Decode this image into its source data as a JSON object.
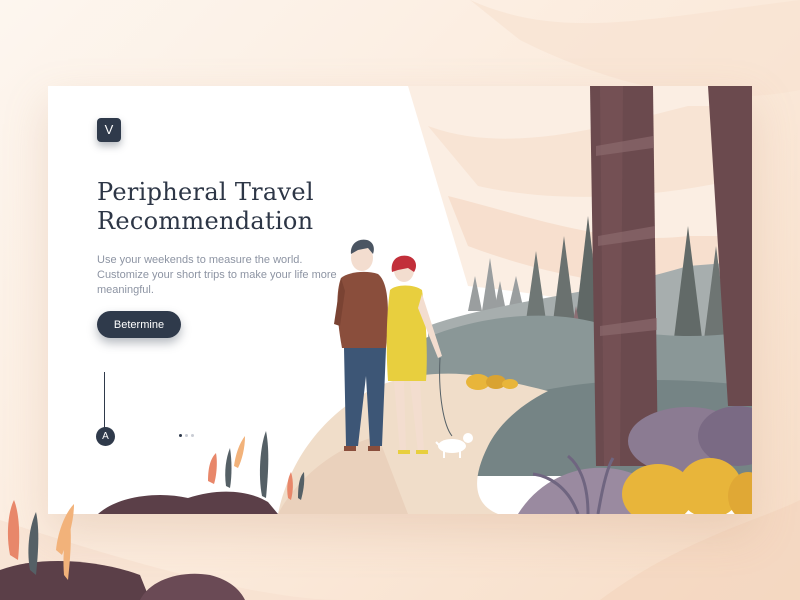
{
  "brand": {
    "logo_letter": "V"
  },
  "hero": {
    "title_line1": "Peripheral Travel",
    "title_line2": "Recommendation",
    "description": "Use your weekends to measure the world. Customize your short trips to make your life more meaningful.",
    "cta_label": "Betermine"
  },
  "scroll": {
    "indicator_letter": "A"
  },
  "pager": {
    "count": 3,
    "active_index": 0
  },
  "colors": {
    "navy": "#2f3a4b",
    "page_bg": "#fbeadb",
    "trunk": "#6b4a4e",
    "grass": "#7e8a8b",
    "path": "#f0ddc9",
    "mustard": "#e8b53a"
  },
  "illustration": {
    "figures": [
      "man",
      "woman",
      "dog"
    ],
    "elements": [
      "tree-trunks",
      "pine-trees",
      "hills",
      "path",
      "bushes",
      "fern"
    ]
  }
}
